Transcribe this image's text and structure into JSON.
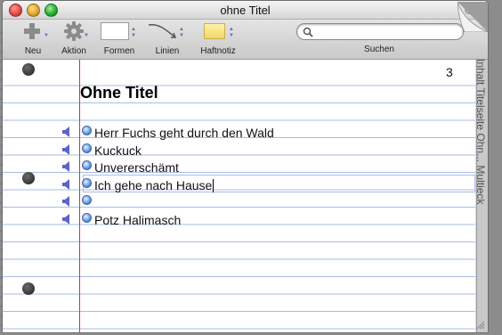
{
  "window": {
    "title": "ohne Titel",
    "close_color": "#e0443e",
    "minimize_color": "#dea123",
    "zoom_color": "#1aab29"
  },
  "toolbar": {
    "items": [
      {
        "label": "Neu",
        "icon": "plus-icon"
      },
      {
        "label": "Aktion",
        "icon": "gear-icon"
      },
      {
        "label": "Formen",
        "icon": "shape-icon"
      },
      {
        "label": "Linien",
        "icon": "line-icon"
      },
      {
        "label": "Haftnotiz",
        "icon": "sticky-note-icon"
      }
    ],
    "search": {
      "label": "Suchen",
      "value": "",
      "placeholder": ""
    }
  },
  "page": {
    "number": "3",
    "title": "Ohne Titel",
    "notes": [
      "Herr Fuchs geht durch den Wald",
      "Kuckuck",
      "Unvererschämt",
      "Ich gehe nach Hause",
      "",
      "Potz Halimasch"
    ],
    "editing_index": 3
  },
  "sidebar": {
    "tabs_text": "Inhalt  Titelseite  Ohn...  Multieck"
  },
  "colors": {
    "margin_line": "#d0353a",
    "ruled_line": "#a9bde6",
    "bullet": "#4d88d6",
    "speaker": "#5c63c9"
  }
}
